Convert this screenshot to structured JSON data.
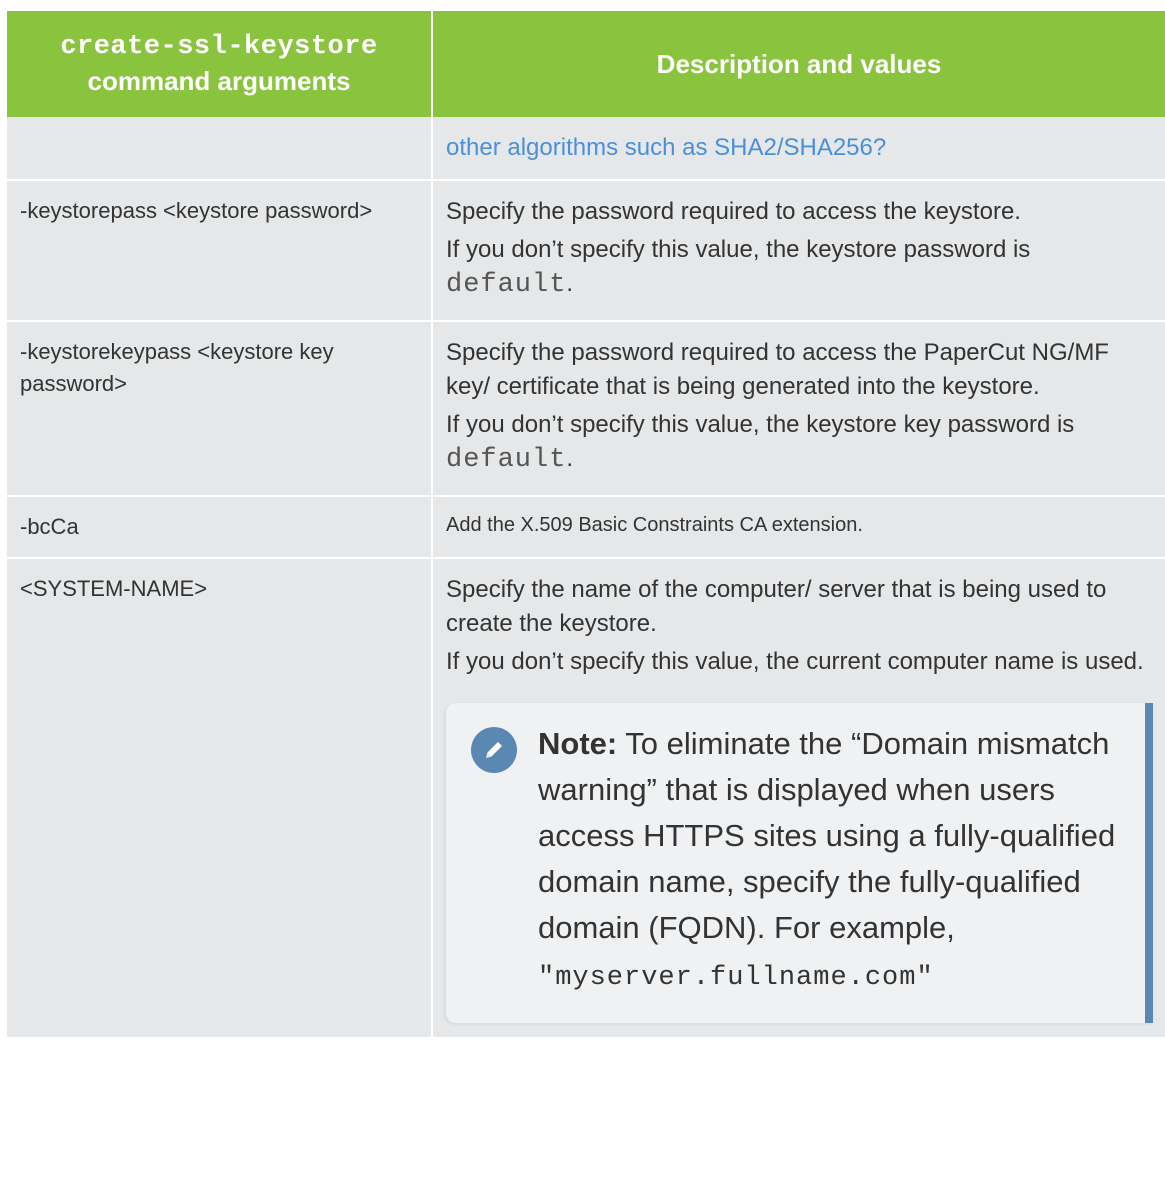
{
  "table": {
    "header": {
      "col1_code": "create-ssl-keystore",
      "col1_text": "command arguments",
      "col2": "Description and values"
    },
    "rows": [
      {
        "arg": "",
        "desc_link": "other algorithms such as SHA2/SHA256?"
      },
      {
        "arg": "-keystorepass <keystore password>",
        "desc1": "Specify the password required to access the keystore.",
        "desc2": "If you don’t specify this value, the keystore password is ",
        "desc2_code": "default",
        "desc2_end": "."
      },
      {
        "arg": "-keystorekeypass <keystore key password>",
        "desc1": "Specify the password required to access the PaperCut NG/MF key/ certificate that is being generated into the keystore.",
        "desc2": "If you don’t specify this value, the keystore key password is ",
        "desc2_code": "default",
        "desc2_end": "."
      },
      {
        "arg": "-bcCa",
        "desc1": "Add the X.509 Basic Constraints CA extension."
      },
      {
        "arg": "<SYSTEM-NAME>",
        "desc1": "Specify the name of the computer/ server that is being used to create the keystore.",
        "desc2": "If you don’t specify this value, the current computer name is used.",
        "note": {
          "label": "Note:",
          "text": " To eliminate the “Domain mismatch warning” that is displayed when users access HTTPS sites using a fully-qualified domain name, specify the fully-qualified domain (FQDN). For example, ",
          "code": "\"myserver.fullname.com\""
        }
      }
    ]
  },
  "colors": {
    "header_bg": "#8ac43f",
    "row_bg": "#e5e7e8",
    "link": "#4a90d9",
    "note_accent": "#5b87b3"
  },
  "icons": {
    "note": "pencil-icon"
  }
}
